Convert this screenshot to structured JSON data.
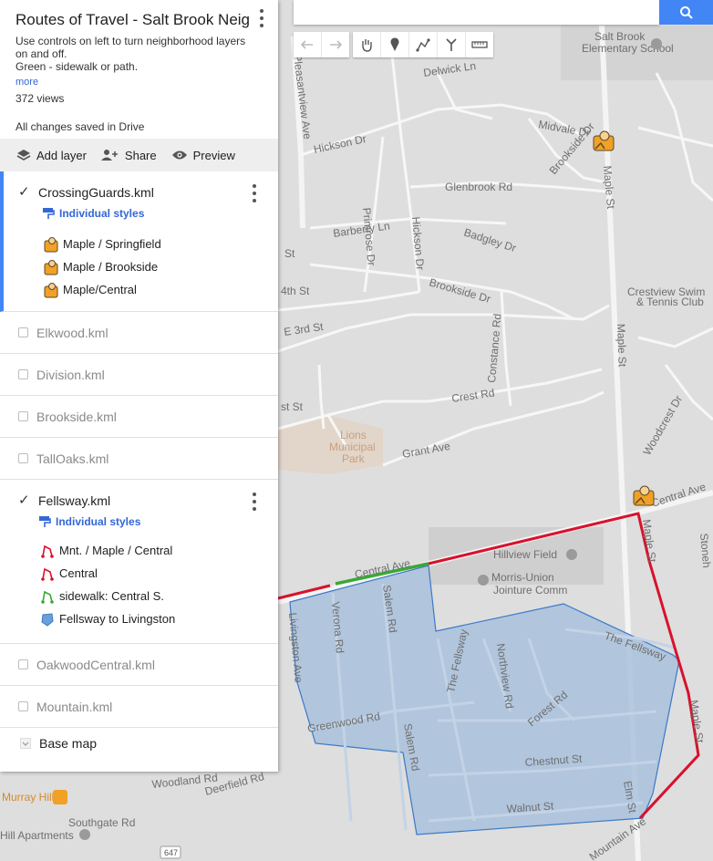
{
  "panel": {
    "title": "Routes of Travel - Salt Brook Neig...",
    "description_line1": "Use controls on left to turn neighborhood layers",
    "description_line2": "on and off.",
    "description_line3": "Green - sidewalk or path.",
    "more_link": "more",
    "views": "372 views",
    "save_status": "All changes saved in Drive"
  },
  "actions": {
    "add_layer": "Add layer",
    "share": "Share",
    "preview": "Preview"
  },
  "layers": [
    {
      "name": "CrossingGuards.kml",
      "checked": true,
      "styles_label": "Individual styles",
      "features": [
        "Maple / Springfield",
        "Maple / Brookside",
        "Maple/Central"
      ]
    },
    {
      "name": "Elkwood.kml",
      "checked": false
    },
    {
      "name": "Division.kml",
      "checked": false
    },
    {
      "name": "Brookside.kml",
      "checked": false
    },
    {
      "name": "TallOaks.kml",
      "checked": false
    },
    {
      "name": "Fellsway.kml",
      "checked": true,
      "styles_label": "Individual styles",
      "features": [
        "Mnt. / Maple / Central",
        "Central",
        "sidewalk: Central S.",
        "Fellsway to Livingston"
      ]
    },
    {
      "name": "OakwoodCentral.kml",
      "checked": false
    },
    {
      "name": "Mountain.kml",
      "checked": false
    }
  ],
  "base_map": "Base map",
  "colors": {
    "route_red": "#d8122b",
    "route_green": "#3aa835",
    "polygon_fill": "#a9c1dc",
    "polygon_stroke": "#3a79c9",
    "accent_blue": "#4285f4"
  },
  "map_labels": {
    "salt_brook_school_1": "Salt Brook",
    "salt_brook_school_2": "Elementary School",
    "delwick": "Delwick Ln",
    "pleasantview": "Pleasantview Ave",
    "hickson_dr": "Hickson Dr",
    "midvale": "Midvale Dr",
    "brookside_dr_top": "Brookside Dr",
    "maple_st_top": "Maple St",
    "glenbrook": "Glenbrook Rd",
    "primrose": "Primrose Dr",
    "barberry": "Barberry Ln",
    "hickson_dr_v": "Hickson Dr",
    "badgley": "Badgley Dr",
    "st_left": "St",
    "fourth_st": "4th St",
    "brookside_dr": "Brookside Dr",
    "crestview_1": "Crestview Swim",
    "crestview_2": "& Tennis Club",
    "e3rd": "E 3rd St",
    "constance": "Constance Rd",
    "maple_st_mid": "Maple St",
    "st_left2": "st St",
    "crest_rd": "Crest Rd",
    "woodcrest": "Woodcrest Dr",
    "lions_1": "Lions",
    "lions_2": "Municipal",
    "lions_3": "Park",
    "grant": "Grant Ave",
    "central_ave_r": "Central Ave",
    "hillview": "Hillview Field",
    "morris_1": "Morris-Union",
    "morris_2": "Jointure Comm",
    "central_ave": "Central Ave",
    "maple_st_low": "Maple St",
    "stoneh": "Stoneh",
    "verona": "Verona Rd",
    "salem_rd": "Salem Rd",
    "the_fellsway": "The Fellsway",
    "northview": "Northview Rd",
    "the_fellsway2": "The Fellsway",
    "livingston": "Livingston Ave",
    "forest": "Forest Rd",
    "greenwood": "Greenwood Rd",
    "salem_rd2": "Salem Rd",
    "maple_st_bottom": "Maple St",
    "chestnut": "Chestnut St",
    "elm": "Elm St",
    "woodland": "Woodland Rd",
    "deerfield": "Deerfield Rd",
    "walnut": "Walnut St",
    "murray_hill": "Murray Hill",
    "southgate": "Southgate Rd",
    "hill_apartments": "Hill Apartments",
    "route_647": "647",
    "mountain_ave": "Mountain Ave"
  },
  "map_icons": [
    "crossing-guard-marker-icon",
    "crossing-guard-marker-icon",
    "school-icon",
    "train-station-icon",
    "place-icon"
  ]
}
